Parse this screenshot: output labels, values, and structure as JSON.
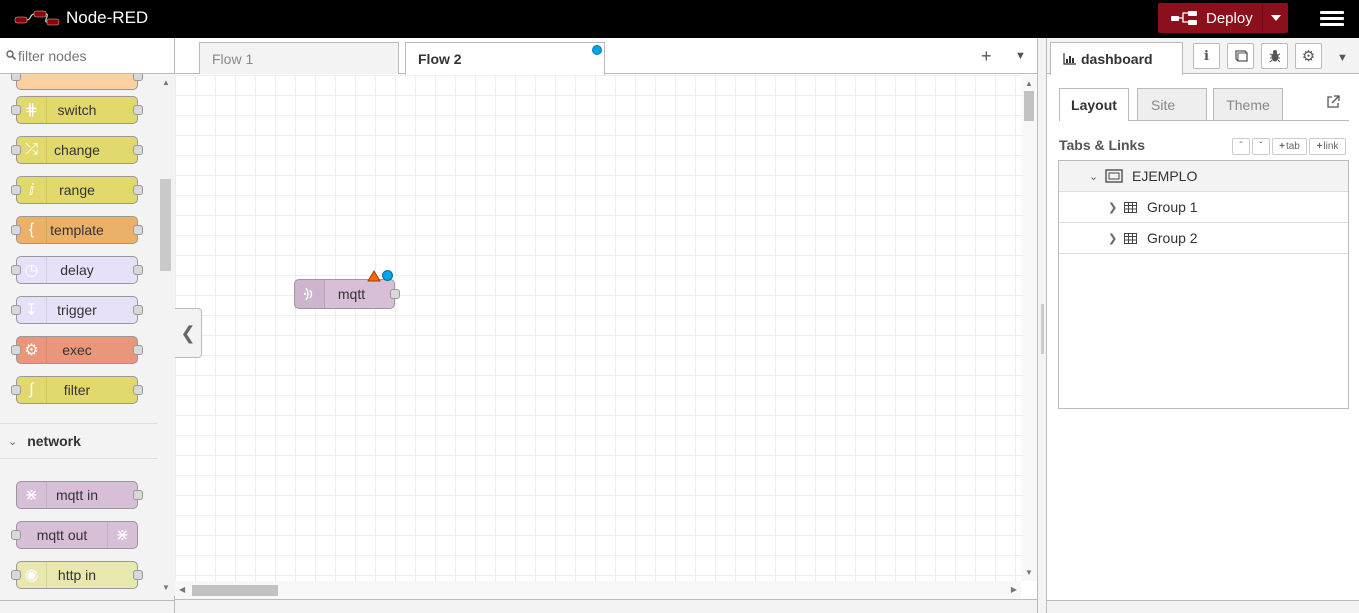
{
  "header": {
    "app_title": "Node-RED",
    "deploy_label": "Deploy"
  },
  "palette": {
    "filter_placeholder": "filter nodes",
    "function_nodes": [
      {
        "label": "switch",
        "color": "#e2d96e",
        "icon": "switch-icon"
      },
      {
        "label": "change",
        "color": "#e2d96e",
        "icon": "change-icon"
      },
      {
        "label": "range",
        "color": "#e2d96e",
        "icon": "range-icon"
      },
      {
        "label": "template",
        "color": "#ebb169",
        "icon": "template-icon"
      },
      {
        "label": "delay",
        "color": "#e6e0f8",
        "icon": "delay-icon"
      },
      {
        "label": "trigger",
        "color": "#e6e0f8",
        "icon": "trigger-icon"
      },
      {
        "label": "exec",
        "color": "#e9967a",
        "icon": "exec-icon"
      },
      {
        "label": "filter",
        "color": "#e2d96e",
        "icon": "filter-icon"
      }
    ],
    "network_category": "network",
    "network_nodes": [
      {
        "label": "mqtt in",
        "color": "#d8bfd8",
        "icon": "mqtt-icon"
      },
      {
        "label": "mqtt out",
        "color": "#d8bfd8",
        "icon": "mqtt-icon"
      },
      {
        "label": "http in",
        "color": "#e7e7ae",
        "icon": "globe-icon"
      }
    ]
  },
  "workspace": {
    "tabs": [
      {
        "label": "Flow 1",
        "active": false
      },
      {
        "label": "Flow 2",
        "active": true
      }
    ],
    "flow_node": {
      "label": "mqtt",
      "color": "#d8bfd8"
    }
  },
  "sidebar": {
    "active_tab": "dashboard",
    "subtabs": [
      "Layout",
      "Site",
      "Theme"
    ],
    "section_title": "Tabs & Links",
    "buttons": {
      "tab": "tab",
      "link": "link"
    },
    "tree": {
      "tab_name": "EJEMPLO",
      "groups": [
        "Group 1",
        "Group 2"
      ]
    }
  }
}
